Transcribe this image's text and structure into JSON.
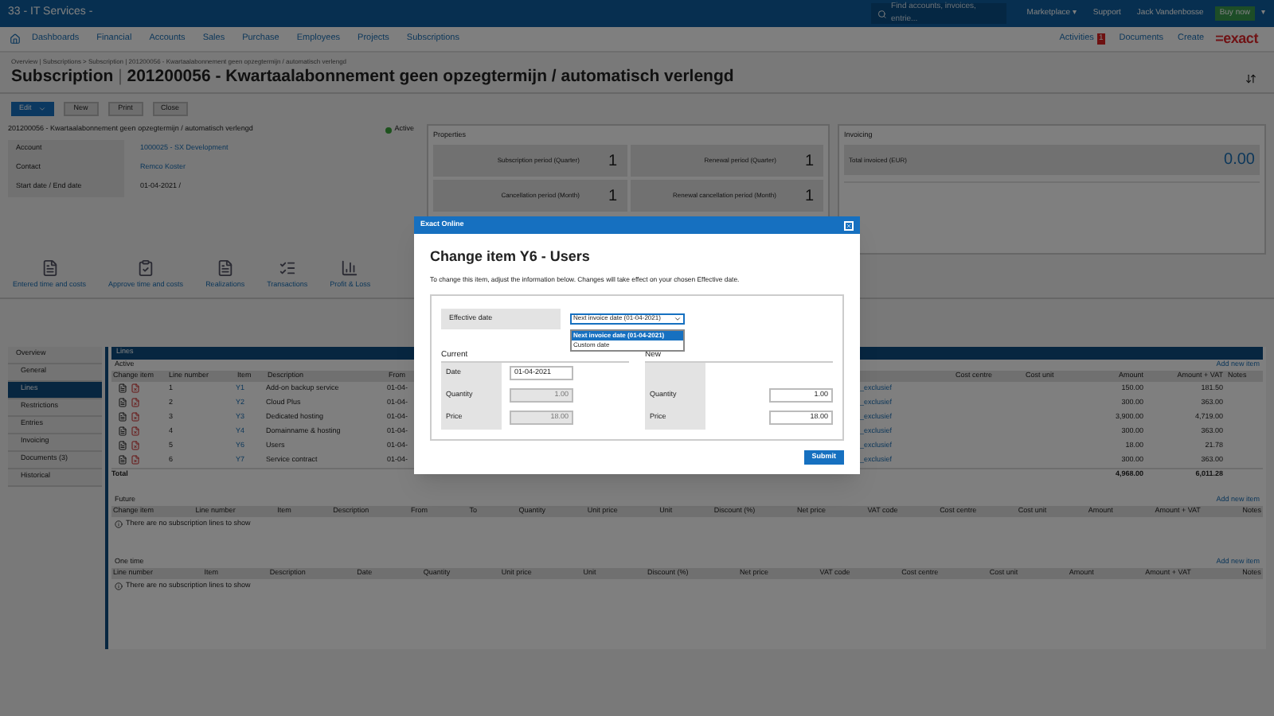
{
  "top_bar": {
    "company": "33 - IT Services -",
    "search": {
      "placeholder": "Find accounts, invoices, entrie..."
    },
    "links": [
      "Marketplace ▾",
      "Support",
      "Jack Vandenbosse"
    ],
    "buy_button": "Buy now",
    "caret": "▾"
  },
  "nav": {
    "items": [
      "Dashboards",
      "Financial",
      "Accounts",
      "Sales",
      "Purchase",
      "Employees",
      "Projects",
      "Subscriptions"
    ],
    "activities": "Activities",
    "activities_count": "1",
    "documents": "Documents",
    "create": "Create",
    "logo": "=exact"
  },
  "breadcrumb": "Overview | Subscriptions > Subscription | 201200056 - Kwartaalabonnement geen opzegtermijn / automatisch verlengd",
  "title": {
    "label": "Subscription",
    "separator": "|",
    "text": "201200056 - Kwartaalabonnement geen opzegtermijn / automatisch verlengd"
  },
  "actions": {
    "edit": "Edit",
    "buttons": [
      "New",
      "Print",
      "Close"
    ]
  },
  "summary": {
    "title": "201200056 - Kwartaalabonnement geen opzegtermijn / automatisch verlengd",
    "status": "Active",
    "fields": [
      {
        "label": "Account",
        "value": "1000025 - SX Development",
        "kind": "link"
      },
      {
        "label": "Contact",
        "value": "Remco Koster",
        "kind": "link"
      },
      {
        "label": "Start date / End date",
        "value": "01-04-2021 /",
        "kind": "text"
      }
    ]
  },
  "properties": {
    "title": "Properties",
    "tiles": [
      {
        "label": "Subscription period (Quarter)",
        "value": "1"
      },
      {
        "label": "Renewal period (Quarter)",
        "value": "1"
      },
      {
        "label": "Cancellation period (Month)",
        "value": "1"
      },
      {
        "label": "Renewal cancellation period (Month)",
        "value": "1"
      }
    ]
  },
  "invoicing": {
    "title": "Invoicing",
    "label": "Total invoiced (EUR)",
    "value": "0.00"
  },
  "toolbar": [
    "Entered time and costs",
    "Approve time and costs",
    "Realizations",
    "Transactions",
    "Profit & Loss"
  ],
  "sidebar": {
    "items": [
      {
        "label": "Overview",
        "selected": false,
        "children": [
          {
            "label": "General",
            "selected": false
          },
          {
            "label": "Lines",
            "selected": true
          },
          {
            "label": "Restrictions",
            "selected": false
          },
          {
            "label": "Entries",
            "selected": false
          },
          {
            "label": "Invoicing",
            "selected": false
          },
          {
            "label": "Documents (3)",
            "selected": false
          },
          {
            "label": "Historical",
            "selected": false
          }
        ]
      }
    ]
  },
  "lines": {
    "title": "Lines",
    "active": {
      "title": "Active",
      "add": "Add new item",
      "left_columns": [
        "Change item",
        "Line number",
        "Item",
        "Description",
        "From"
      ],
      "right_columns": [
        "Cost centre",
        "Cost unit",
        "Amount",
        "Amount + VAT",
        "Notes"
      ],
      "rows": [
        {
          "line_number": "1",
          "item": "Y1",
          "description": "Add-on backup service",
          "from": "01-04-",
          "vat_code": "_exclusief",
          "amount": "150.00",
          "amount_vat": "181.50"
        },
        {
          "line_number": "2",
          "item": "Y2",
          "description": "Cloud Plus",
          "from": "01-04-",
          "vat_code": "_exclusief",
          "amount": "300.00",
          "amount_vat": "363.00"
        },
        {
          "line_number": "3",
          "item": "Y3",
          "description": "Dedicated hosting",
          "from": "01-04-",
          "vat_code": "_exclusief",
          "amount": "3,900.00",
          "amount_vat": "4,719.00"
        },
        {
          "line_number": "4",
          "item": "Y4",
          "description": "Domainname & hosting",
          "from": "01-04-",
          "vat_code": "_exclusief",
          "amount": "300.00",
          "amount_vat": "363.00"
        },
        {
          "line_number": "5",
          "item": "Y6",
          "description": "Users",
          "from": "01-04-",
          "vat_code": "_exclusief",
          "amount": "18.00",
          "amount_vat": "21.78"
        },
        {
          "line_number": "6",
          "item": "Y7",
          "description": "Service contract",
          "from": "01-04-",
          "vat_code": "_exclusief",
          "amount": "300.00",
          "amount_vat": "363.00"
        }
      ],
      "total": {
        "label": "Total",
        "amount": "4,968.00",
        "amount_vat": "6,011.28"
      }
    },
    "sections": [
      {
        "title": "Future",
        "add": "Add new item",
        "columns": [
          "Change item",
          "Line number",
          "Item",
          "Description",
          "From",
          "To",
          "Quantity",
          "Unit price",
          "Unit",
          "Discount (%)",
          "Net price",
          "VAT code",
          "Cost centre",
          "Cost unit",
          "Amount",
          "Amount + VAT",
          "Notes"
        ],
        "empty": "There are no subscription lines to show"
      },
      {
        "title": "One time",
        "add": "Add new item",
        "columns": [
          "Line number",
          "Item",
          "Description",
          "Date",
          "Quantity",
          "Unit price",
          "Unit",
          "Discount (%)",
          "Net price",
          "VAT code",
          "Cost centre",
          "Cost unit",
          "Amount",
          "Amount + VAT",
          "Notes"
        ],
        "empty": "There are no subscription lines to show"
      }
    ]
  },
  "dialog": {
    "window_title": "Exact Online",
    "heading": "Change item Y6 - Users",
    "description": "To change this item, adjust the information below. Changes will take effect on your chosen Effective date.",
    "effective_date": {
      "label": "Effective date",
      "value": "Next invoice date (01-04-2021)",
      "expanded": true,
      "options": [
        {
          "label": "Next invoice date (01-04-2021)",
          "selected": true
        },
        {
          "label": "Custom date",
          "selected": false
        }
      ]
    },
    "current": {
      "title": "Current",
      "fields": [
        {
          "label": "Date",
          "value": "01-04-2021",
          "disabled": false
        },
        {
          "label": "Quantity",
          "value": "1.00",
          "disabled": true
        },
        {
          "label": "Price",
          "value": "18.00",
          "disabled": true
        }
      ]
    },
    "new": {
      "title": "New",
      "fields": [
        {
          "label": "Quantity",
          "value": "1.00",
          "disabled": false
        },
        {
          "label": "Price",
          "value": "18.00",
          "disabled": false
        }
      ]
    },
    "submit": "Submit"
  }
}
